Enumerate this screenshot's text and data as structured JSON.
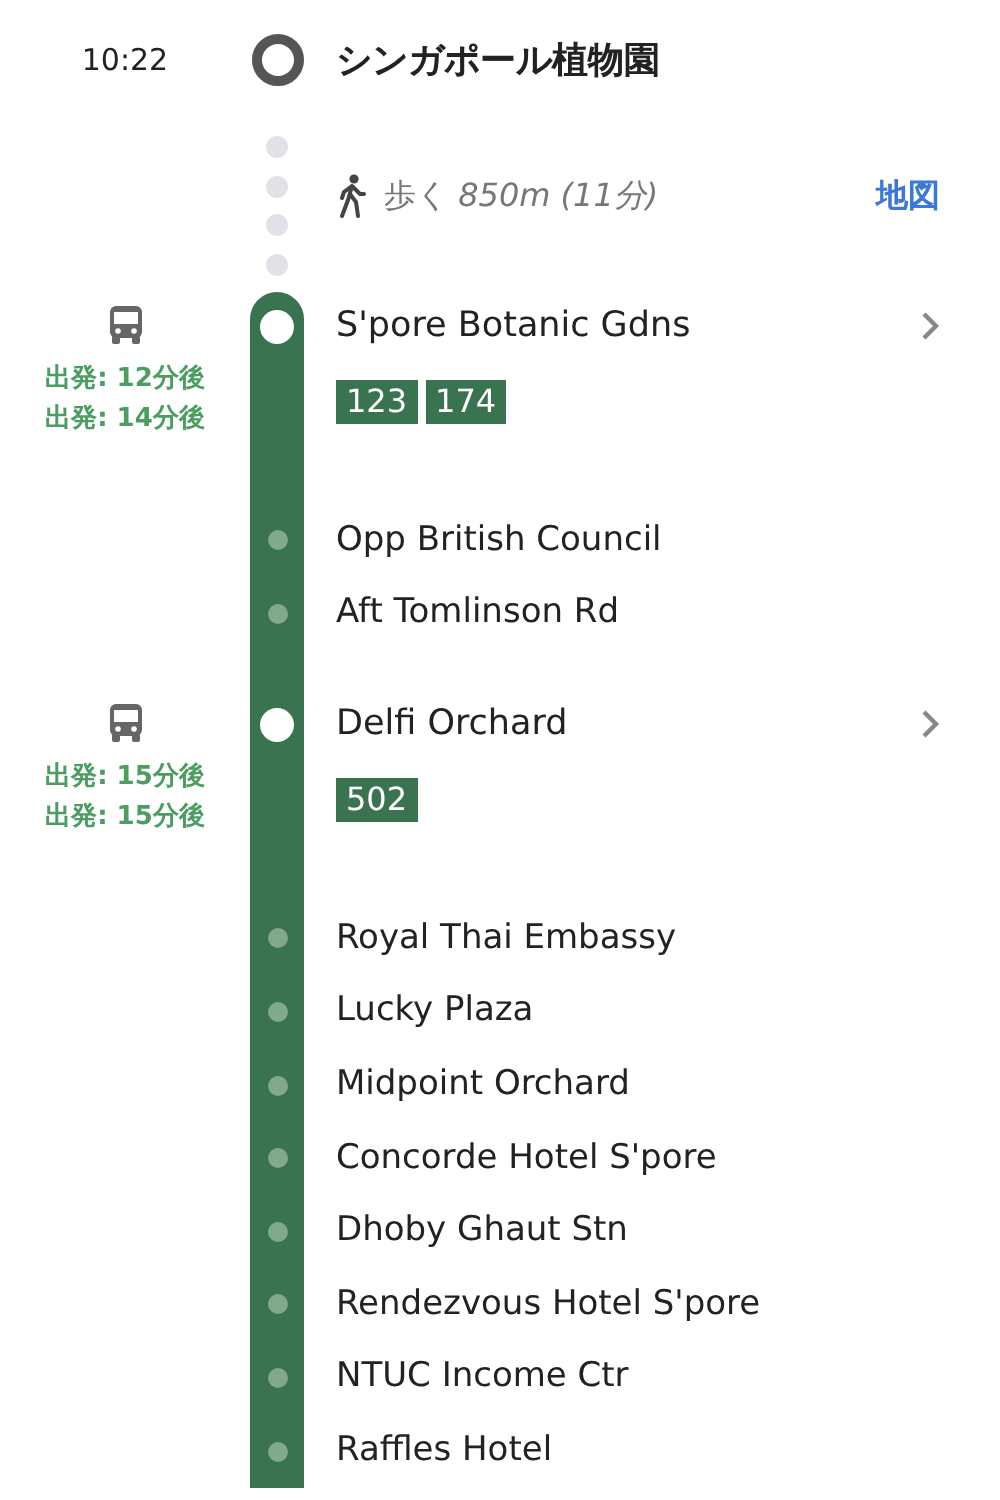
{
  "origin": {
    "time": "10:22",
    "name": "シンガポール植物園"
  },
  "walk": {
    "label": "歩く",
    "distance": "850m (11分)",
    "map_link": "地図"
  },
  "legs": [
    {
      "board_stop": "S'pore Botanic Gdns",
      "departures": [
        "出発: 12分後",
        "出発: 14分後"
      ],
      "routes": [
        "123",
        "174"
      ],
      "stops": [
        "Opp British Council",
        "Aft Tomlinson Rd"
      ]
    },
    {
      "board_stop": "Delfi Orchard",
      "departures": [
        "出発: 15分後",
        "出発: 15分後"
      ],
      "routes": [
        "502"
      ],
      "stops": [
        "Royal Thai Embassy",
        "Lucky Plaza",
        "Midpoint Orchard",
        "Concorde Hotel S'pore",
        "Dhoby Ghaut Stn",
        "Rendezvous Hotel S'pore",
        "NTUC Income Ctr",
        "Raffles Hotel"
      ]
    }
  ]
}
